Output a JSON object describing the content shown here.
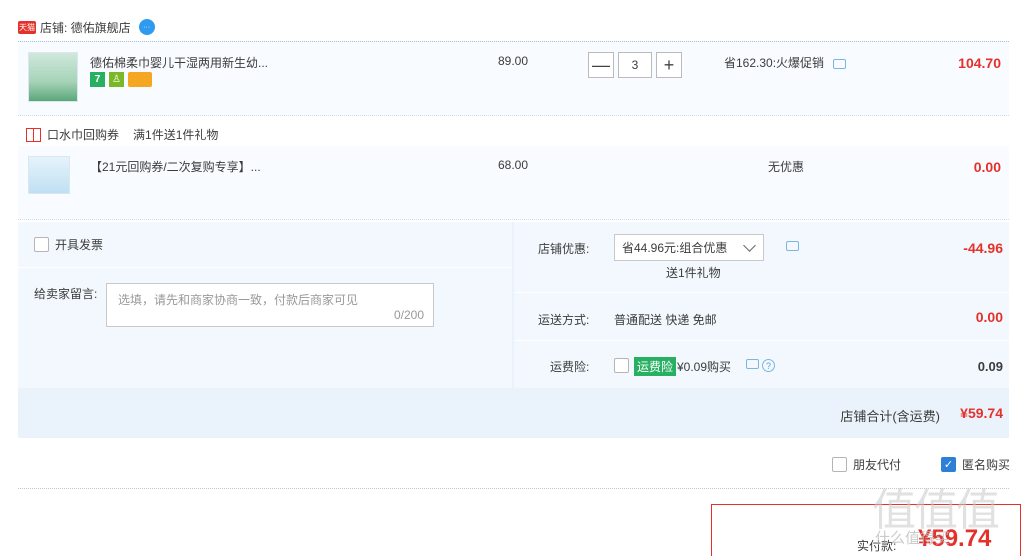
{
  "store": {
    "badge": "天猫",
    "name": "店铺: 德佑旗舰店"
  },
  "item1": {
    "title": "德佑棉柔巾婴儿干湿两用新生幼...",
    "badges": [
      "7"
    ],
    "price": "89.00",
    "quantity": "3",
    "qty_minus": "—",
    "qty_plus": "+",
    "discount": "省162.30:火爆促销",
    "subtotal": "104.70"
  },
  "gift": {
    "name": "口水巾回购券",
    "condition": "满1件送1件礼物"
  },
  "item2": {
    "title": "【21元回购券/二次复购专享】...",
    "price": "68.00",
    "discount": "无优惠",
    "subtotal": "0.00"
  },
  "invoice": {
    "label": "开具发票"
  },
  "note": {
    "label": "给卖家留言:",
    "placeholder": "选填，请先和商家协商一致，付款后商家可见",
    "count": "0/200"
  },
  "store_discount": {
    "label": "店铺优惠:",
    "selected": "省44.96元:组合优惠",
    "gift_note": "送1件礼物",
    "amount": "-44.96"
  },
  "shipping": {
    "label": "运送方式:",
    "value": "普通配送 快递 免邮",
    "amount": "0.00"
  },
  "insurance": {
    "label": "运费险:",
    "badge": "运费险",
    "price": "¥0.09购买",
    "amount": "0.09"
  },
  "total": {
    "label": "店铺合计(含运费)",
    "value": "¥59.74"
  },
  "options": {
    "friend_pay": "朋友代付",
    "anonymous": "匿名购买"
  },
  "pay": {
    "label": "实付款:",
    "value": "¥59.74"
  },
  "watermark": {
    "logo": "值值值",
    "site": "什么值得买"
  }
}
